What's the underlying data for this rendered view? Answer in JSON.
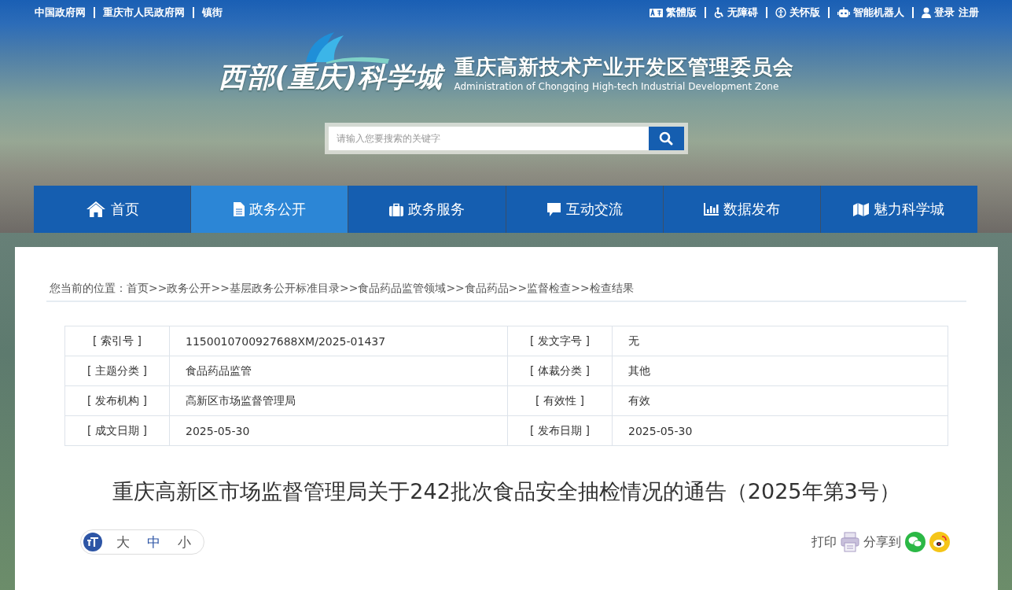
{
  "top_links": [
    "中国政府网",
    "重庆市人民政府网",
    "镇街"
  ],
  "top_tools": [
    {
      "kind": "traditional",
      "label": "繁體版"
    },
    {
      "kind": "accessible",
      "label": "无障碍"
    },
    {
      "kind": "care",
      "label": "关怀版"
    },
    {
      "kind": "robot",
      "label": "智能机器人"
    },
    {
      "kind": "user",
      "label": "登录 注册"
    }
  ],
  "logo": {
    "name": "西部(重庆)科学城",
    "title": "重庆高新技术产业开发区管理委员会",
    "subtitle": "Administration of Chongqing High-tech Industrial Development Zone"
  },
  "search": {
    "placeholder": "请输入您要搜索的关键字"
  },
  "nav": [
    {
      "kind": "home",
      "label": "首页",
      "selected": false
    },
    {
      "kind": "doc",
      "label": "政务公开",
      "selected": true
    },
    {
      "kind": "case",
      "label": "政务服务",
      "selected": false
    },
    {
      "kind": "chat",
      "label": "互动交流",
      "selected": false
    },
    {
      "kind": "chart",
      "label": "数据发布",
      "selected": false
    },
    {
      "kind": "map",
      "label": "魅力科学城",
      "selected": false
    }
  ],
  "breadcrumb": "您当前的位置：首页>>政务公开>>基层政务公开标准目录>>食品药品监管领域>>食品药品>>监督检查>>检查结果",
  "meta": [
    {
      "label_1": "[ 索引号 ]",
      "value_1": "1150010700927688XM/2025-01437",
      "label_2": "[ 发文字号 ]",
      "value_2": "无"
    },
    {
      "label_1": "[ 主题分类 ]",
      "value_1": "食品药品监管",
      "label_2": "[ 体裁分类 ]",
      "value_2": "其他"
    },
    {
      "label_1": "[ 发布机构 ]",
      "value_1": "高新区市场监督管理局",
      "label_2": "[ 有效性 ]",
      "value_2": "有效"
    },
    {
      "label_1": "[ 成文日期 ]",
      "value_1": "2025-05-30",
      "label_2": "[ 发布日期 ]",
      "value_2": "2025-05-30"
    }
  ],
  "article_title": "重庆高新区市场监督管理局关于242批次食品安全抽检情况的通告（2025年第3号）",
  "font_sizes": [
    {
      "label": "大",
      "selected": false
    },
    {
      "label": "中",
      "selected": true
    },
    {
      "label": "小",
      "selected": false
    }
  ],
  "print_label": "打印",
  "share_label": "分享到"
}
